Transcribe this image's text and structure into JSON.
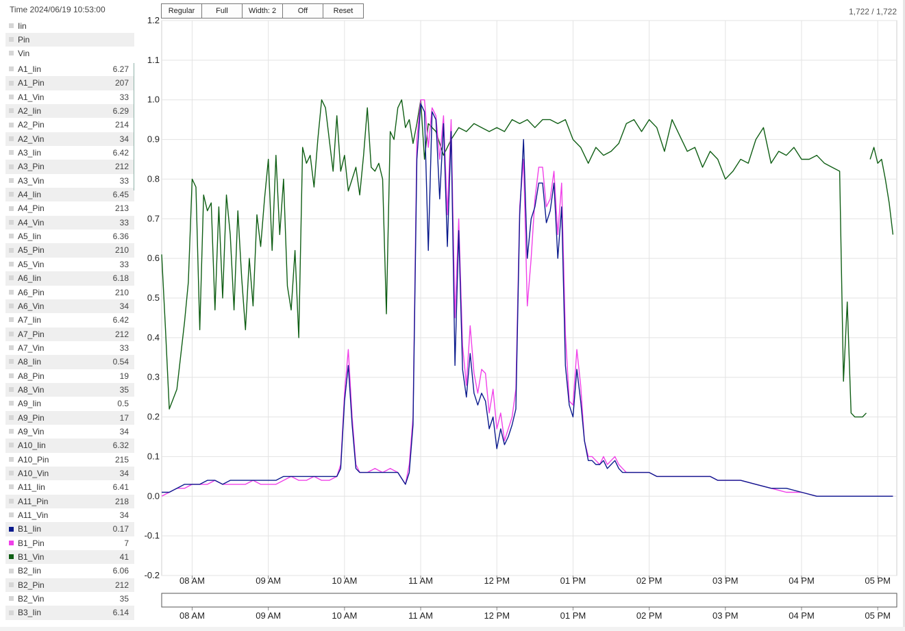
{
  "header": {
    "time_label": "Time 2024/06/19 10:53:00"
  },
  "toolbar": {
    "regular_label": "Regular",
    "full_label": "Full",
    "width_label": "Width: 2",
    "off_label": "Off",
    "reset_label": "Reset"
  },
  "counter": "1,722 / 1,722",
  "legend_top": [
    {
      "name": "Iin"
    },
    {
      "name": "Pin"
    },
    {
      "name": "Vin"
    }
  ],
  "legend": [
    {
      "name": "A1_Iin",
      "value": "6.27"
    },
    {
      "name": "A1_Pin",
      "value": "207"
    },
    {
      "name": "A1_Vin",
      "value": "33"
    },
    {
      "name": "A2_Iin",
      "value": "6.29"
    },
    {
      "name": "A2_Pin",
      "value": "214"
    },
    {
      "name": "A2_Vin",
      "value": "34"
    },
    {
      "name": "A3_Iin",
      "value": "6.42"
    },
    {
      "name": "A3_Pin",
      "value": "212"
    },
    {
      "name": "A3_Vin",
      "value": "33"
    },
    {
      "name": "A4_Iin",
      "value": "6.45"
    },
    {
      "name": "A4_Pin",
      "value": "213"
    },
    {
      "name": "A4_Vin",
      "value": "33"
    },
    {
      "name": "A5_Iin",
      "value": "6.36"
    },
    {
      "name": "A5_Pin",
      "value": "210"
    },
    {
      "name": "A5_Vin",
      "value": "33"
    },
    {
      "name": "A6_Iin",
      "value": "6.18"
    },
    {
      "name": "A6_Pin",
      "value": "210"
    },
    {
      "name": "A6_Vin",
      "value": "34"
    },
    {
      "name": "A7_Iin",
      "value": "6.42"
    },
    {
      "name": "A7_Pin",
      "value": "212"
    },
    {
      "name": "A7_Vin",
      "value": "33"
    },
    {
      "name": "A8_Iin",
      "value": "0.54"
    },
    {
      "name": "A8_Pin",
      "value": "19"
    },
    {
      "name": "A8_Vin",
      "value": "35"
    },
    {
      "name": "A9_Iin",
      "value": "0.5"
    },
    {
      "name": "A9_Pin",
      "value": "17"
    },
    {
      "name": "A9_Vin",
      "value": "34"
    },
    {
      "name": "A10_Iin",
      "value": "6.32"
    },
    {
      "name": "A10_Pin",
      "value": "215"
    },
    {
      "name": "A10_Vin",
      "value": "34"
    },
    {
      "name": "A11_Iin",
      "value": "6.41"
    },
    {
      "name": "A11_Pin",
      "value": "218"
    },
    {
      "name": "A11_Vin",
      "value": "34"
    },
    {
      "name": "B1_Iin",
      "value": "0.17",
      "color": "#0a1a8c"
    },
    {
      "name": "B1_Pin",
      "value": "7",
      "color": "#f040e8"
    },
    {
      "name": "B1_Vin",
      "value": "41",
      "color": "#0f5e14"
    },
    {
      "name": "B2_Iin",
      "value": "6.06"
    },
    {
      "name": "B2_Pin",
      "value": "212"
    },
    {
      "name": "B2_Vin",
      "value": "35"
    },
    {
      "name": "B3_Iin",
      "value": "6.14"
    }
  ],
  "chart_data": {
    "type": "line",
    "y_ticks": [
      "1.2",
      "1.1",
      "1.0",
      "0.9",
      "0.8",
      "0.7",
      "0.6",
      "0.5",
      "0.4",
      "0.3",
      "0.2",
      "0.1",
      "0.0",
      "-0.1",
      "-0.2"
    ],
    "ylim": [
      -0.2,
      1.2
    ],
    "x_ticks": [
      "08 AM",
      "09 AM",
      "10 AM",
      "11 AM",
      "12 PM",
      "01 PM",
      "02 PM",
      "03 PM",
      "04 PM",
      "05 PM"
    ],
    "xlim": [
      7.6,
      17.25
    ],
    "grid": true,
    "series": [
      {
        "name": "B1_Vin",
        "color": "#0f5e14",
        "x": [
          7.6,
          7.65,
          7.7,
          7.8,
          7.9,
          7.95,
          8.0,
          8.05,
          8.1,
          8.15,
          8.2,
          8.25,
          8.3,
          8.35,
          8.4,
          8.45,
          8.5,
          8.55,
          8.6,
          8.65,
          8.7,
          8.75,
          8.8,
          8.85,
          8.9,
          8.95,
          9.0,
          9.05,
          9.1,
          9.15,
          9.2,
          9.25,
          9.3,
          9.35,
          9.4,
          9.45,
          9.5,
          9.55,
          9.6,
          9.65,
          9.7,
          9.75,
          9.8,
          9.85,
          9.9,
          9.95,
          10.0,
          10.05,
          10.1,
          10.15,
          10.2,
          10.25,
          10.3,
          10.35,
          10.4,
          10.45,
          10.5,
          10.55,
          10.6,
          10.65,
          10.7,
          10.75,
          10.8,
          10.85,
          10.9,
          10.95,
          11.0,
          11.05,
          11.1,
          11.2,
          11.3,
          11.4,
          11.5,
          11.6,
          11.7,
          11.8,
          11.9,
          12.0,
          12.1,
          12.2,
          12.3,
          12.4,
          12.5,
          12.6,
          12.7,
          12.8,
          12.9,
          13.0,
          13.1,
          13.2,
          13.3,
          13.4,
          13.5,
          13.6,
          13.7,
          13.8,
          13.9,
          14.0,
          14.1,
          14.2,
          14.3,
          14.4,
          14.5,
          14.6,
          14.7,
          14.8,
          14.9,
          15.0,
          15.1,
          15.2,
          15.3,
          15.4,
          15.5,
          15.6,
          15.7,
          15.8,
          15.9,
          16.0,
          16.1,
          16.2,
          16.3,
          16.4,
          16.5,
          16.55,
          16.6,
          16.65,
          16.7,
          16.75,
          16.8,
          16.85,
          16.9,
          16.95,
          17.0,
          17.05,
          17.1,
          17.15,
          17.2
        ],
        "y": [
          0.61,
          0.42,
          0.22,
          0.27,
          0.44,
          0.54,
          0.8,
          0.78,
          0.42,
          0.76,
          0.72,
          0.74,
          0.47,
          0.73,
          0.5,
          0.76,
          0.66,
          0.47,
          0.72,
          0.55,
          0.42,
          0.6,
          0.48,
          0.71,
          0.63,
          0.75,
          0.85,
          0.62,
          0.86,
          0.66,
          0.8,
          0.53,
          0.47,
          0.62,
          0.4,
          0.88,
          0.84,
          0.86,
          0.78,
          0.9,
          1.0,
          0.98,
          0.9,
          0.82,
          0.96,
          0.82,
          0.86,
          0.77,
          0.8,
          0.83,
          0.76,
          0.86,
          0.98,
          0.83,
          0.82,
          0.84,
          0.8,
          0.46,
          0.92,
          0.9,
          0.98,
          1.0,
          0.93,
          0.95,
          0.89,
          0.94,
          1.0,
          0.85,
          0.94,
          0.92,
          0.86,
          0.9,
          0.93,
          0.92,
          0.94,
          0.93,
          0.92,
          0.93,
          0.92,
          0.95,
          0.94,
          0.95,
          0.93,
          0.95,
          0.95,
          0.94,
          0.95,
          0.9,
          0.88,
          0.84,
          0.88,
          0.86,
          0.87,
          0.89,
          0.94,
          0.95,
          0.92,
          0.95,
          0.93,
          0.87,
          0.95,
          0.91,
          0.87,
          0.88,
          0.83,
          0.87,
          0.85,
          0.8,
          0.82,
          0.85,
          0.84,
          0.9,
          0.93,
          0.84,
          0.87,
          0.86,
          0.88,
          0.85,
          0.85,
          0.86,
          0.84,
          0.83,
          0.82,
          0.29,
          0.49,
          0.21,
          0.2,
          0.2,
          0.2,
          0.21,
          0.85,
          0.88,
          0.84,
          0.85,
          0.8,
          0.74,
          0.66
        ],
        "break_after_x": 16.85
      },
      {
        "name": "B1_Pin",
        "color": "#f040e8",
        "x": [
          7.6,
          7.7,
          7.8,
          7.9,
          8.0,
          8.1,
          8.2,
          8.3,
          8.4,
          8.5,
          8.6,
          8.7,
          8.8,
          8.9,
          9.0,
          9.1,
          9.2,
          9.3,
          9.4,
          9.5,
          9.6,
          9.7,
          9.8,
          9.9,
          9.95,
          10.0,
          10.05,
          10.1,
          10.15,
          10.2,
          10.25,
          10.3,
          10.4,
          10.5,
          10.6,
          10.7,
          10.8,
          10.85,
          10.9,
          10.95,
          11.0,
          11.05,
          11.1,
          11.15,
          11.2,
          11.25,
          11.3,
          11.35,
          11.4,
          11.45,
          11.5,
          11.55,
          11.6,
          11.65,
          11.7,
          11.75,
          11.8,
          11.85,
          11.9,
          11.95,
          12.0,
          12.05,
          12.1,
          12.15,
          12.2,
          12.25,
          12.3,
          12.35,
          12.4,
          12.45,
          12.5,
          12.55,
          12.6,
          12.65,
          12.7,
          12.75,
          12.8,
          12.85,
          12.9,
          12.95,
          13.0,
          13.05,
          13.1,
          13.15,
          13.2,
          13.25,
          13.3,
          13.35,
          13.4,
          13.45,
          13.5,
          13.55,
          13.6,
          13.65,
          13.7,
          13.75,
          13.8,
          13.85,
          13.9,
          13.95,
          14.0,
          14.1,
          14.2,
          14.3,
          14.4,
          14.5,
          14.6,
          14.7,
          14.8,
          14.9,
          15.0,
          15.2,
          15.4,
          15.6,
          15.8,
          16.0,
          16.2,
          16.4,
          16.5,
          16.6,
          16.7,
          16.8,
          16.9,
          17.0,
          17.1,
          17.2
        ],
        "y": [
          0.0,
          0.01,
          0.02,
          0.02,
          0.03,
          0.03,
          0.03,
          0.04,
          0.03,
          0.03,
          0.03,
          0.03,
          0.04,
          0.03,
          0.03,
          0.03,
          0.04,
          0.05,
          0.04,
          0.04,
          0.05,
          0.04,
          0.04,
          0.05,
          0.08,
          0.26,
          0.37,
          0.2,
          0.08,
          0.06,
          0.06,
          0.06,
          0.07,
          0.06,
          0.07,
          0.06,
          0.03,
          0.08,
          0.2,
          0.9,
          1.0,
          1.0,
          0.88,
          0.98,
          0.96,
          0.85,
          0.96,
          0.71,
          0.95,
          0.45,
          0.7,
          0.38,
          0.28,
          0.43,
          0.31,
          0.26,
          0.32,
          0.31,
          0.21,
          0.27,
          0.17,
          0.21,
          0.14,
          0.17,
          0.2,
          0.27,
          0.73,
          0.85,
          0.48,
          0.6,
          0.75,
          0.83,
          0.83,
          0.73,
          0.75,
          0.82,
          0.66,
          0.79,
          0.41,
          0.24,
          0.23,
          0.37,
          0.28,
          0.14,
          0.1,
          0.1,
          0.09,
          0.08,
          0.1,
          0.08,
          0.09,
          0.1,
          0.08,
          0.07,
          0.06,
          0.06,
          0.06,
          0.06,
          0.06,
          0.06,
          0.06,
          0.05,
          0.05,
          0.05,
          0.05,
          0.05,
          0.05,
          0.05,
          0.05,
          0.04,
          0.04,
          0.04,
          0.03,
          0.02,
          0.01,
          0.01,
          0.0,
          0.0,
          0.0,
          0.0,
          0.0,
          0.0,
          0.0,
          0.0,
          0.0,
          0.0
        ]
      },
      {
        "name": "B1_Iin",
        "color": "#0a1a8c",
        "x": [
          7.6,
          7.7,
          7.8,
          7.9,
          8.0,
          8.1,
          8.2,
          8.3,
          8.4,
          8.5,
          8.6,
          8.7,
          8.8,
          8.9,
          9.0,
          9.1,
          9.2,
          9.3,
          9.4,
          9.5,
          9.6,
          9.7,
          9.8,
          9.9,
          9.95,
          10.0,
          10.05,
          10.1,
          10.15,
          10.2,
          10.25,
          10.3,
          10.4,
          10.5,
          10.6,
          10.7,
          10.8,
          10.85,
          10.9,
          10.95,
          11.0,
          11.05,
          11.1,
          11.15,
          11.2,
          11.25,
          11.3,
          11.35,
          11.4,
          11.45,
          11.5,
          11.55,
          11.6,
          11.65,
          11.7,
          11.75,
          11.8,
          11.85,
          11.9,
          11.95,
          12.0,
          12.05,
          12.1,
          12.15,
          12.2,
          12.25,
          12.3,
          12.35,
          12.4,
          12.45,
          12.5,
          12.55,
          12.6,
          12.65,
          12.7,
          12.75,
          12.8,
          12.85,
          12.9,
          12.95,
          13.0,
          13.05,
          13.1,
          13.15,
          13.2,
          13.25,
          13.3,
          13.35,
          13.4,
          13.45,
          13.5,
          13.55,
          13.6,
          13.65,
          13.7,
          13.75,
          13.8,
          13.85,
          13.9,
          13.95,
          14.0,
          14.1,
          14.2,
          14.3,
          14.4,
          14.5,
          14.6,
          14.7,
          14.8,
          14.9,
          15.0,
          15.2,
          15.4,
          15.6,
          15.8,
          16.0,
          16.2,
          16.4,
          16.5,
          16.6,
          16.7,
          16.8,
          16.9,
          17.0,
          17.1,
          17.2
        ],
        "y": [
          0.01,
          0.01,
          0.02,
          0.03,
          0.03,
          0.03,
          0.04,
          0.04,
          0.03,
          0.04,
          0.04,
          0.04,
          0.04,
          0.04,
          0.04,
          0.04,
          0.05,
          0.05,
          0.05,
          0.05,
          0.05,
          0.05,
          0.05,
          0.05,
          0.07,
          0.24,
          0.33,
          0.18,
          0.07,
          0.06,
          0.06,
          0.06,
          0.06,
          0.06,
          0.06,
          0.06,
          0.03,
          0.06,
          0.18,
          0.85,
          0.99,
          0.97,
          0.62,
          0.97,
          0.95,
          0.75,
          0.94,
          0.63,
          0.92,
          0.33,
          0.67,
          0.32,
          0.25,
          0.36,
          0.26,
          0.23,
          0.26,
          0.24,
          0.17,
          0.2,
          0.12,
          0.17,
          0.13,
          0.15,
          0.18,
          0.22,
          0.71,
          0.9,
          0.6,
          0.7,
          0.73,
          0.79,
          0.79,
          0.69,
          0.72,
          0.79,
          0.6,
          0.73,
          0.33,
          0.23,
          0.2,
          0.32,
          0.24,
          0.14,
          0.09,
          0.09,
          0.08,
          0.08,
          0.09,
          0.07,
          0.08,
          0.09,
          0.07,
          0.06,
          0.06,
          0.06,
          0.06,
          0.06,
          0.06,
          0.06,
          0.06,
          0.05,
          0.05,
          0.05,
          0.05,
          0.05,
          0.05,
          0.05,
          0.05,
          0.04,
          0.04,
          0.04,
          0.03,
          0.02,
          0.02,
          0.01,
          0.0,
          0.0,
          0.0,
          0.0,
          0.0,
          0.0,
          0.0,
          0.0,
          0.0,
          0.0
        ]
      }
    ]
  }
}
